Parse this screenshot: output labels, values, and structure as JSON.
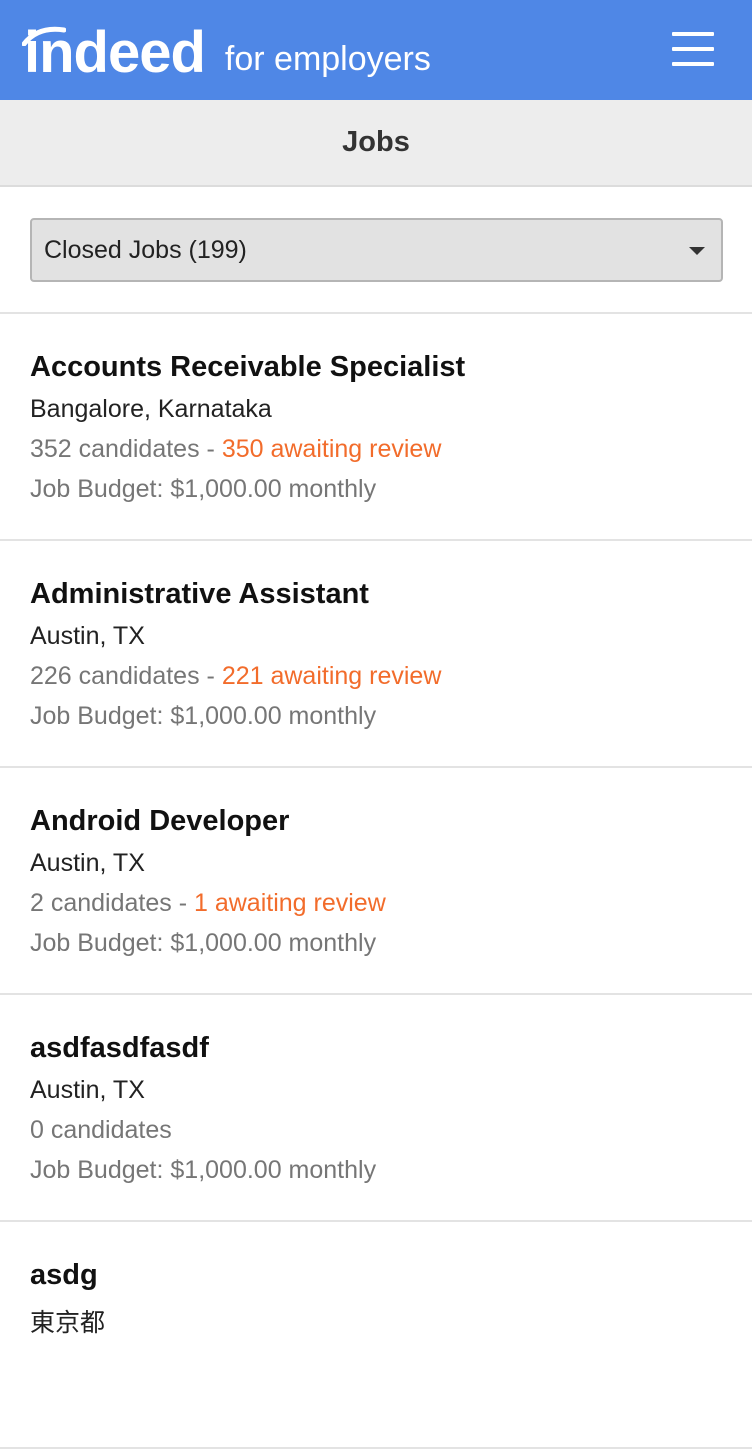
{
  "header": {
    "logo_word": "indeed",
    "logo_sub": "for employers",
    "menu_icon": "hamburger-menu-icon",
    "background_color": "#4f87e6"
  },
  "subheader": {
    "title": "Jobs"
  },
  "filter": {
    "selected": "Closed Jobs (199)"
  },
  "jobs": [
    {
      "title": "Accounts Receivable Specialist",
      "location": "Bangalore, Karnataka",
      "candidates": "352 candidates",
      "separator": " - ",
      "awaiting": "350 awaiting review",
      "budget": "Job Budget: $1,000.00 monthly"
    },
    {
      "title": "Administrative Assistant",
      "location": "Austin, TX",
      "candidates": "226 candidates",
      "separator": " - ",
      "awaiting": "221 awaiting review",
      "budget": "Job Budget: $1,000.00 monthly"
    },
    {
      "title": "Android Developer",
      "location": "Austin, TX",
      "candidates": "2 candidates",
      "separator": " - ",
      "awaiting": "1 awaiting review",
      "budget": "Job Budget: $1,000.00 monthly"
    },
    {
      "title": "asdfasdfasdf",
      "location": "Austin, TX",
      "candidates": "0 candidates",
      "budget": "Job Budget: $1,000.00 monthly"
    },
    {
      "title": "asdg",
      "location": "東京都"
    }
  ],
  "colors": {
    "accent_orange": "#f26c2b",
    "muted_gray": "#767676"
  }
}
